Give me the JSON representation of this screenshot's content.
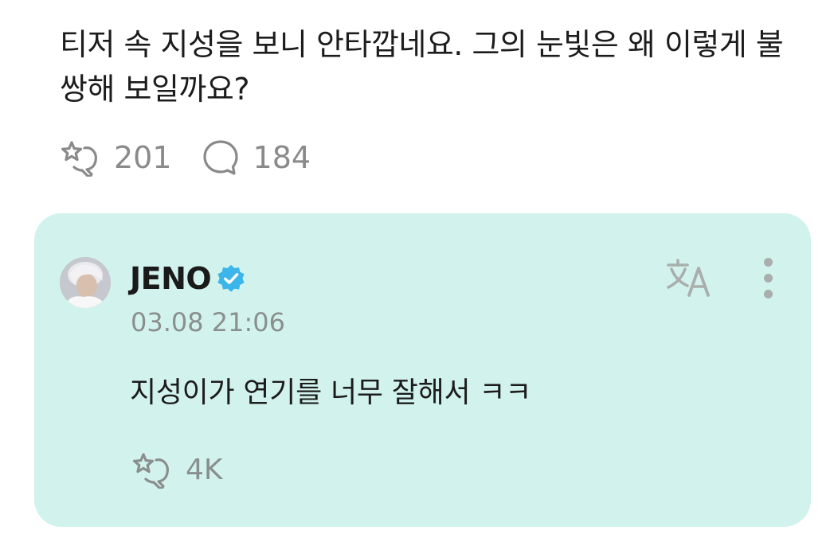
{
  "post": {
    "text": "티저 속 지성을 보니 안타깝네요. 그의 눈빛은 왜 이렇게 불쌍해 보일까요?",
    "actions": {
      "like_icon": "reaction-star-icon",
      "like_count": "201",
      "comment_icon": "comment-bubble-icon",
      "comment_count": "184"
    }
  },
  "reply": {
    "author": "JENO",
    "verified_icon": "verified-badge-icon",
    "timestamp": "03.08 21:06",
    "text": "지성이가 연기를 너무 잘해서 ㅋㅋ",
    "like_icon": "reaction-star-icon",
    "like_count": "4K",
    "translate_icon": "translate-icon",
    "more_icon": "more-vertical-icon"
  },
  "colors": {
    "reply_background": "#d2f3ed",
    "verified_badge": "#3cb6ea",
    "muted_text": "#8a8a8a"
  }
}
